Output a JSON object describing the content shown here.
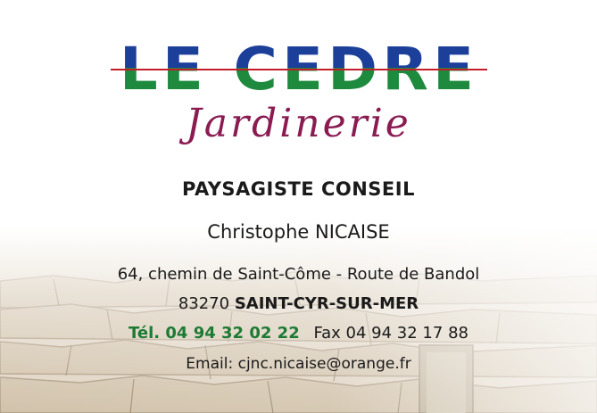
{
  "logo": {
    "word": "LE CEDRE"
  },
  "subtitle": "Jardinerie",
  "role": "PAYSAGISTE CONSEIL",
  "name": "Christophe NICAISE",
  "address": {
    "line1": "64, chemin de Saint-Côme - Route de Bandol",
    "postcode": "83270",
    "city": "SAINT-CYR-SUR-MER"
  },
  "contact": {
    "tel": "Tél. 04 94 32 02 22",
    "fax": "Fax 04 94 32 17 88",
    "email": "Email: cjnc.nicaise@orange.fr"
  },
  "colors": {
    "logo_green": "#1d8a3e",
    "logo_blue": "#1c3f9a",
    "logo_line": "#c21d2a",
    "subtitle": "#8a1c52",
    "tel": "#1d7a33"
  }
}
